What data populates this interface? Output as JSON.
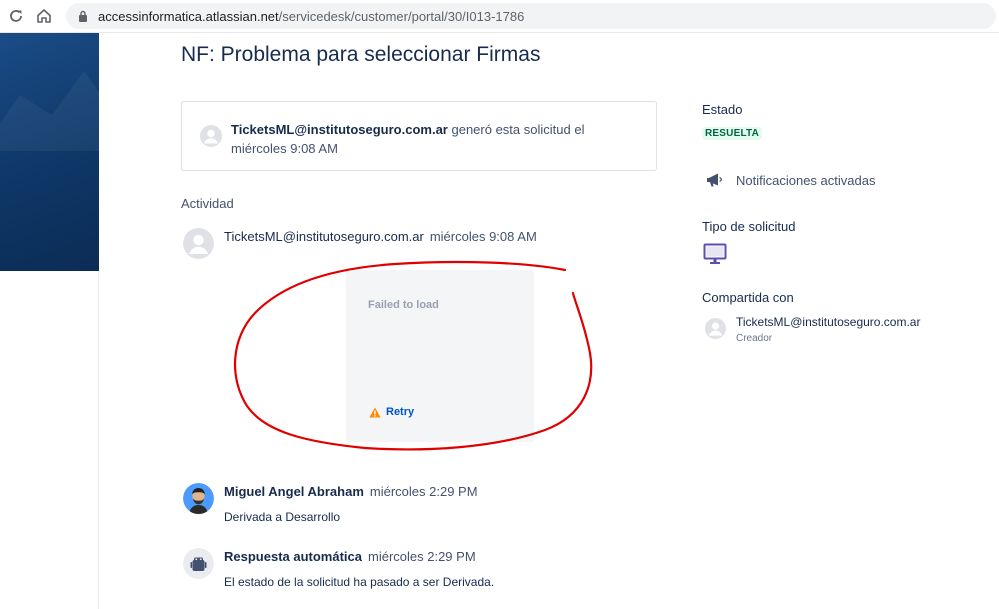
{
  "browser": {
    "url_host": "accessinformatica.atlassian.net",
    "url_path": "/servicedesk/customer/portal/30/I013-1786"
  },
  "page": {
    "title": "NF: Problema para seleccionar Firmas"
  },
  "request_card": {
    "author": "TicketsML@institutoseguro.com.ar",
    "text_before_time": " generó esta solicitud el ",
    "time": "miércoles 9:08 AM"
  },
  "activity": {
    "label": "Actividad",
    "items": [
      {
        "author": "TicketsML@institutoseguro.com.ar",
        "time": "miércoles 9:08 AM",
        "attachment": {
          "status": "Failed to load",
          "retry_label": "Retry"
        }
      },
      {
        "author": "Miguel Angel Abraham",
        "time": "miércoles 2:29 PM",
        "body": "Derivada a Desarrollo"
      },
      {
        "author": "Respuesta automática",
        "time": "miércoles 2:29 PM",
        "body": "El estado de la solicitud ha pasado a ser Derivada."
      }
    ]
  },
  "sidebar": {
    "status_label": "Estado",
    "status_value": "RESUELTA",
    "notifications": "Notificaciones activadas",
    "request_type_label": "Tipo de solicitud",
    "shared_label": "Compartida con",
    "shared_name": "TicketsML@institutoseguro.com.ar",
    "shared_role": "Creador"
  },
  "colors": {
    "status_bg": "#e3fcef",
    "status_text": "#006644",
    "link": "#0052cc",
    "annotation": "#e00000",
    "request_type_icon": "#5e4db2"
  },
  "icons": [
    "reload-icon",
    "home-icon",
    "lock-icon",
    "user-avatar-icon",
    "warning-icon",
    "megaphone-icon",
    "monitor-icon",
    "robot-icon"
  ]
}
